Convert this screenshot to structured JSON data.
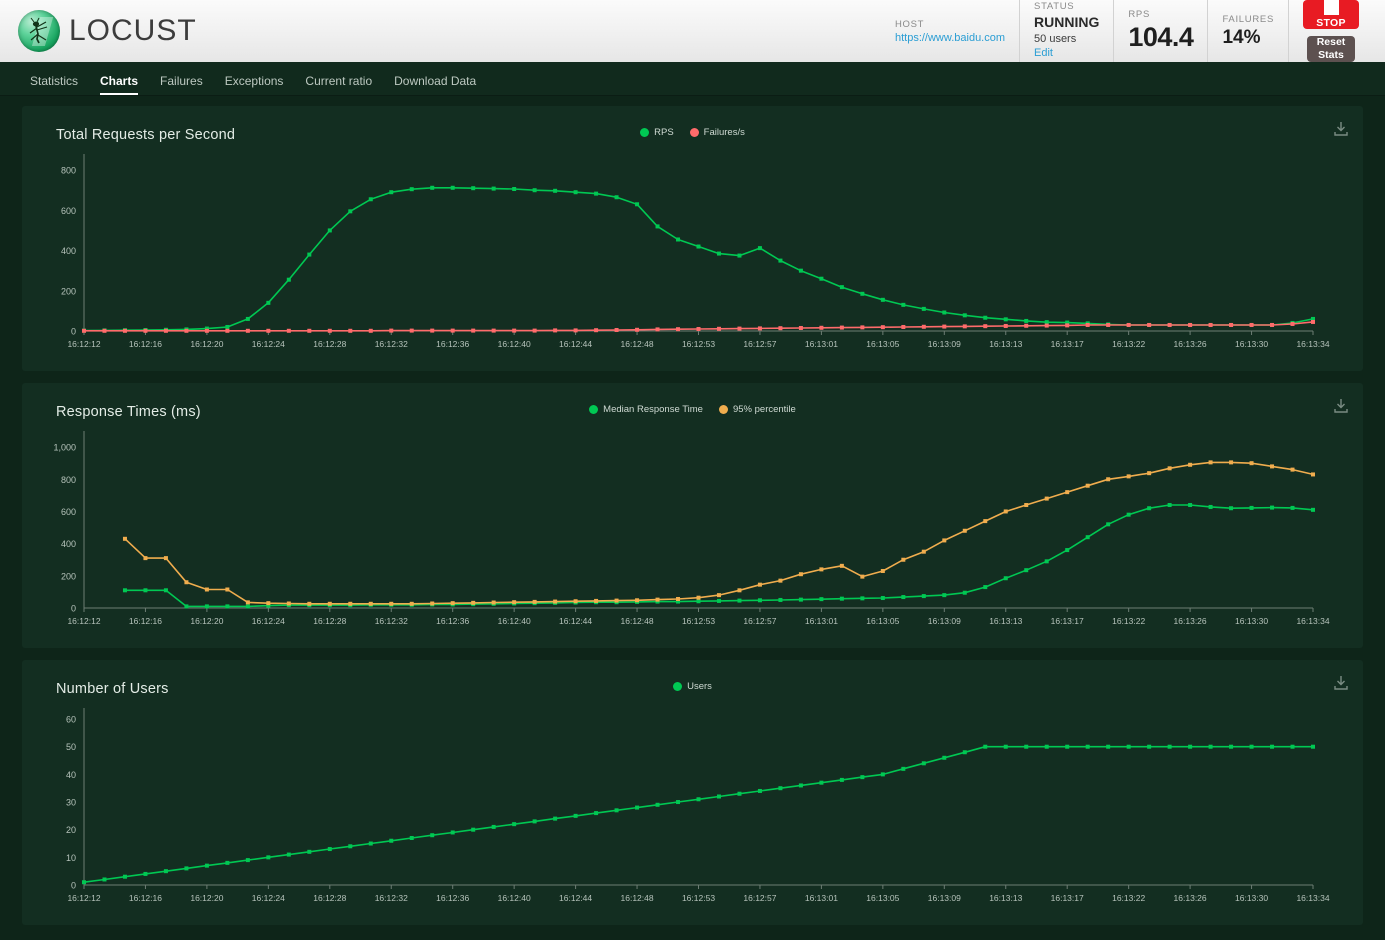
{
  "header": {
    "logo_text": "LOCUST",
    "logo_icon": "locust-bug-icon",
    "stats": [
      {
        "label": "HOST",
        "value": "https://www.baidu.com",
        "kind": "link"
      },
      {
        "label": "STATUS",
        "value": "RUNNING",
        "sub": "50 users",
        "edit": "Edit"
      },
      {
        "label": "RPS",
        "value": "104.4"
      },
      {
        "label": "FAILURES",
        "value": "14%"
      }
    ],
    "stop_button": "STOP",
    "reset_button": "Reset Stats"
  },
  "nav": {
    "items": [
      {
        "label": "Statistics",
        "active": false
      },
      {
        "label": "Charts",
        "active": true
      },
      {
        "label": "Failures",
        "active": false
      },
      {
        "label": "Exceptions",
        "active": false
      },
      {
        "label": "Current ratio",
        "active": false
      },
      {
        "label": "Download Data",
        "active": false
      }
    ]
  },
  "colors": {
    "rps_green": "#00c853",
    "failures_red": "#ff6b6b",
    "percentile_amber": "#f0ad4e",
    "panel_bg": "#132e21",
    "page_bg": "#0e2519",
    "nav_bg": "#112a1d",
    "accent_link": "#2b9ed4",
    "stop_red": "#e81b23",
    "reset_brown": "#5d5150"
  },
  "chart_data": [
    {
      "type": "line",
      "title": "Total Requests per Second",
      "xlabel": "",
      "ylabel": "",
      "ylim": [
        0,
        880
      ],
      "yticks": [
        0,
        200,
        400,
        600,
        800
      ],
      "ytick_labels": [
        "0",
        "200",
        "400",
        "600",
        "800"
      ],
      "grid": false,
      "legend_position": "top-center",
      "download_icon": "download-icon",
      "x": [
        "16:12:12",
        "16:12:13",
        "16:12:14",
        "16:12:15",
        "16:12:16",
        "16:12:17",
        "16:12:18",
        "16:12:19",
        "16:12:20",
        "16:12:21",
        "16:12:22",
        "16:12:23",
        "16:12:24",
        "16:12:25",
        "16:12:26",
        "16:12:27",
        "16:12:28",
        "16:12:29",
        "16:12:30",
        "16:12:31",
        "16:12:32",
        "16:12:33",
        "16:12:34",
        "16:12:35",
        "16:12:36",
        "16:12:37",
        "16:12:38",
        "16:12:39",
        "16:12:40",
        "16:12:41",
        "16:12:42",
        "16:12:43",
        "16:12:44",
        "16:12:45",
        "16:12:46",
        "16:12:47",
        "16:12:48",
        "16:12:49",
        "16:12:51",
        "16:12:53",
        "16:12:55",
        "16:12:57",
        "16:12:59",
        "16:13:01",
        "16:13:03",
        "16:13:05",
        "16:13:07",
        "16:13:09",
        "16:13:11",
        "16:13:13",
        "16:13:15",
        "16:13:17",
        "16:13:20",
        "16:13:22",
        "16:13:24",
        "16:13:26",
        "16:13:28",
        "16:13:30",
        "16:13:32",
        "16:13:34",
        "16:13:36"
      ],
      "xtick_labels": [
        "16:12:12",
        "16:12:16",
        "16:12:20",
        "16:12:24",
        "16:12:28",
        "16:12:32",
        "16:12:36",
        "16:12:40",
        "16:12:44",
        "16:12:48",
        "16:12:53",
        "16:12:57",
        "16:13:01",
        "16:13:05",
        "16:13:09",
        "16:13:13",
        "16:13:17",
        "16:13:22",
        "16:13:26",
        "16:13:30",
        "16:13:34"
      ],
      "series": [
        {
          "name": "RPS",
          "color": "#00c853",
          "values": [
            2,
            3,
            4,
            5,
            6,
            8,
            12,
            20,
            60,
            140,
            255,
            380,
            500,
            595,
            655,
            690,
            705,
            712,
            712,
            710,
            708,
            706,
            700,
            697,
            690,
            683,
            665,
            630,
            520,
            455,
            420,
            385,
            375,
            412,
            350,
            300,
            260,
            218,
            185,
            155,
            130,
            110,
            92,
            78,
            66,
            58,
            50,
            44,
            42,
            38,
            33,
            30,
            30,
            30,
            30,
            30,
            30,
            30,
            30,
            40,
            60
          ]
        },
        {
          "name": "Failures/s",
          "color": "#ff6b6b",
          "values": [
            1,
            1,
            1,
            1,
            1,
            1,
            1,
            1,
            1,
            1,
            1,
            1,
            1,
            1,
            1,
            2,
            2,
            2,
            2,
            2,
            2,
            2,
            2,
            3,
            3,
            4,
            5,
            6,
            8,
            9,
            10,
            11,
            12,
            13,
            14,
            15,
            16,
            17,
            18,
            19,
            20,
            21,
            22,
            23,
            24,
            25,
            26,
            27,
            28,
            30,
            30,
            30,
            30,
            30,
            30,
            30,
            30,
            30,
            30,
            35,
            45
          ]
        }
      ]
    },
    {
      "type": "line",
      "title": "Response Times (ms)",
      "xlabel": "",
      "ylabel": "",
      "ylim": [
        0,
        1100
      ],
      "yticks": [
        0,
        200,
        400,
        600,
        800,
        1000
      ],
      "ytick_labels": [
        "0",
        "200",
        "400",
        "600",
        "800",
        "1,000"
      ],
      "grid": false,
      "legend_position": "top-center",
      "download_icon": "download-icon",
      "x": [
        "16:12:12",
        "16:12:13",
        "16:12:14",
        "16:12:15",
        "16:12:16",
        "16:12:17",
        "16:12:18",
        "16:12:19",
        "16:12:20",
        "16:12:21",
        "16:12:22",
        "16:12:23",
        "16:12:24",
        "16:12:25",
        "16:12:26",
        "16:12:27",
        "16:12:28",
        "16:12:29",
        "16:12:30",
        "16:12:31",
        "16:12:32",
        "16:12:33",
        "16:12:34",
        "16:12:35",
        "16:12:36",
        "16:12:37",
        "16:12:38",
        "16:12:39",
        "16:12:40",
        "16:12:41",
        "16:12:42",
        "16:12:43",
        "16:12:44",
        "16:12:45",
        "16:12:46",
        "16:12:47",
        "16:12:48",
        "16:12:49",
        "16:12:51",
        "16:12:53",
        "16:12:55",
        "16:12:57",
        "16:12:59",
        "16:13:01",
        "16:13:03",
        "16:13:05",
        "16:13:07",
        "16:13:09",
        "16:13:11",
        "16:13:13",
        "16:13:15",
        "16:13:17",
        "16:13:20",
        "16:13:22",
        "16:13:24",
        "16:13:26",
        "16:13:28",
        "16:13:30",
        "16:13:32",
        "16:13:34",
        "16:13:36"
      ],
      "xtick_labels": [
        "16:12:12",
        "16:12:16",
        "16:12:20",
        "16:12:24",
        "16:12:28",
        "16:12:32",
        "16:12:36",
        "16:12:40",
        "16:12:44",
        "16:12:48",
        "16:12:53",
        "16:12:57",
        "16:13:01",
        "16:13:05",
        "16:13:09",
        "16:13:13",
        "16:13:17",
        "16:13:22",
        "16:13:26",
        "16:13:30",
        "16:13:34"
      ],
      "series": [
        {
          "name": "Median Response Time",
          "color": "#00c853",
          "values": [
            null,
            null,
            110,
            110,
            110,
            10,
            10,
            10,
            10,
            15,
            18,
            18,
            18,
            18,
            20,
            20,
            20,
            22,
            22,
            24,
            26,
            28,
            30,
            32,
            34,
            36,
            36,
            38,
            40,
            40,
            42,
            44,
            46,
            48,
            50,
            52,
            55,
            58,
            60,
            62,
            68,
            74,
            80,
            95,
            130,
            185,
            235,
            290,
            360,
            440,
            520,
            580,
            620,
            640,
            640,
            628,
            620,
            622,
            624,
            622,
            610
          ]
        },
        {
          "name": "95% percentile",
          "color": "#f0ad4e",
          "values": [
            null,
            null,
            430,
            310,
            310,
            160,
            115,
            115,
            35,
            30,
            28,
            26,
            26,
            26,
            26,
            26,
            26,
            28,
            30,
            32,
            34,
            36,
            38,
            40,
            42,
            44,
            46,
            48,
            52,
            56,
            64,
            80,
            110,
            145,
            170,
            210,
            240,
            262,
            195,
            230,
            300,
            350,
            420,
            480,
            540,
            600,
            640,
            680,
            720,
            760,
            800,
            818,
            838,
            868,
            890,
            905,
            905,
            900,
            880,
            860,
            830
          ]
        }
      ]
    },
    {
      "type": "line",
      "title": "Number of Users",
      "xlabel": "",
      "ylabel": "",
      "ylim": [
        0,
        64
      ],
      "yticks": [
        0,
        10,
        20,
        30,
        40,
        50,
        60
      ],
      "ytick_labels": [
        "0",
        "10",
        "20",
        "30",
        "40",
        "50",
        "60"
      ],
      "grid": false,
      "legend_position": "top-center",
      "download_icon": "download-icon",
      "x": [
        "16:12:12",
        "16:12:13",
        "16:12:14",
        "16:12:15",
        "16:12:16",
        "16:12:17",
        "16:12:18",
        "16:12:19",
        "16:12:20",
        "16:12:21",
        "16:12:22",
        "16:12:23",
        "16:12:24",
        "16:12:25",
        "16:12:26",
        "16:12:27",
        "16:12:28",
        "16:12:29",
        "16:12:30",
        "16:12:31",
        "16:12:32",
        "16:12:33",
        "16:12:34",
        "16:12:35",
        "16:12:36",
        "16:12:37",
        "16:12:38",
        "16:12:39",
        "16:12:40",
        "16:12:41",
        "16:12:42",
        "16:12:43",
        "16:12:44",
        "16:12:45",
        "16:12:46",
        "16:12:47",
        "16:12:48",
        "16:12:49",
        "16:12:51",
        "16:12:53",
        "16:12:55",
        "16:12:57",
        "16:12:59",
        "16:13:01",
        "16:13:03",
        "16:13:05",
        "16:13:07",
        "16:13:09",
        "16:13:11",
        "16:13:13",
        "16:13:15",
        "16:13:17",
        "16:13:20",
        "16:13:22",
        "16:13:24",
        "16:13:26",
        "16:13:28",
        "16:13:30",
        "16:13:32",
        "16:13:34",
        "16:13:36"
      ],
      "xtick_labels": [
        "16:12:12",
        "16:12:16",
        "16:12:20",
        "16:12:24",
        "16:12:28",
        "16:12:32",
        "16:12:36",
        "16:12:40",
        "16:12:44",
        "16:12:48",
        "16:12:53",
        "16:12:57",
        "16:13:01",
        "16:13:05",
        "16:13:09",
        "16:13:13",
        "16:13:17",
        "16:13:22",
        "16:13:26",
        "16:13:30",
        "16:13:34"
      ],
      "series": [
        {
          "name": "Users",
          "color": "#00c853",
          "values": [
            1,
            2,
            3,
            4,
            5,
            6,
            7,
            8,
            9,
            10,
            11,
            12,
            13,
            14,
            15,
            16,
            17,
            18,
            19,
            20,
            21,
            22,
            23,
            24,
            25,
            26,
            27,
            28,
            29,
            30,
            31,
            32,
            33,
            34,
            35,
            36,
            37,
            38,
            39,
            40,
            42,
            44,
            46,
            48,
            50,
            50,
            50,
            50,
            50,
            50,
            50,
            50,
            50,
            50,
            50,
            50,
            50,
            50,
            50,
            50,
            50
          ]
        }
      ]
    }
  ]
}
